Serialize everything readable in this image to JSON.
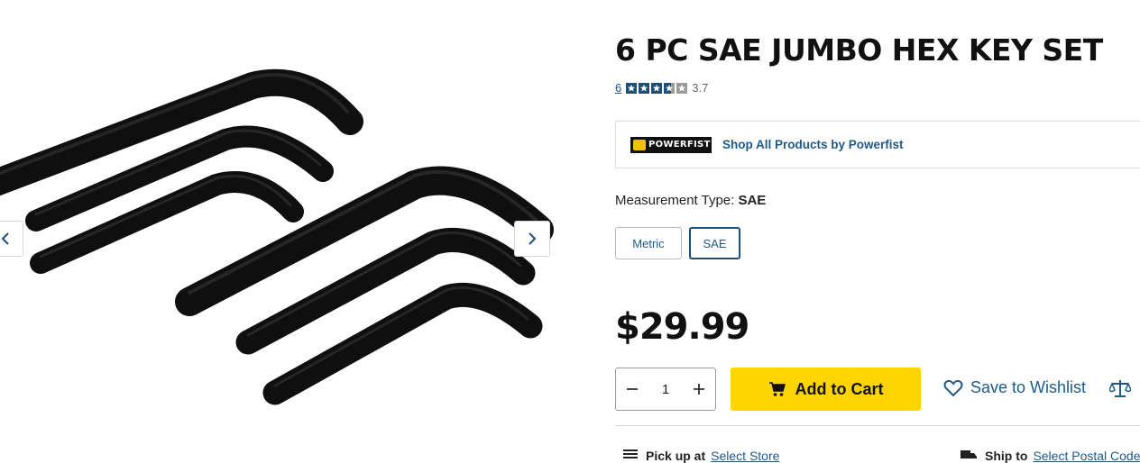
{
  "product": {
    "title": "6 PC SAE JUMBO HEX KEY SET",
    "image_alt": "six black hex keys",
    "review_count": "6",
    "rating_value": "3.7",
    "rating_stars": 3.7
  },
  "brand": {
    "logo_text": "POWERFIST",
    "link_label": "Shop All Products by Powerfist"
  },
  "measurement": {
    "label": "Measurement Type:",
    "selected": "SAE",
    "options": [
      "Metric",
      "SAE"
    ]
  },
  "pricing": {
    "price": "$29.99"
  },
  "purchase": {
    "quantity": "1",
    "add_to_cart_label": "Add to Cart",
    "wishlist_label": "Save to Wishlist"
  },
  "fulfillment": {
    "pickup_label": "Pick up at",
    "pickup_link": "Select Store",
    "ship_label": "Ship to",
    "ship_link": "Select Postal Code"
  },
  "colors": {
    "accent_blue": "#1d5a8a",
    "cart_yellow": "#ffd400",
    "text_dark": "#111111"
  },
  "icons": [
    "chevron-left-icon",
    "chevron-right-icon",
    "star-icon",
    "minus-icon",
    "plus-icon",
    "cart-icon",
    "heart-icon",
    "scale-icon",
    "store-icon",
    "truck-icon"
  ]
}
